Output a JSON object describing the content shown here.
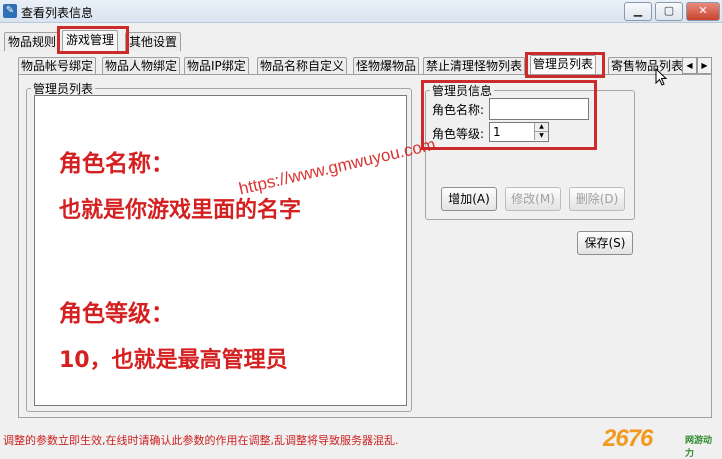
{
  "window": {
    "title": "查看列表信息",
    "controls": {
      "minimize": "▁",
      "maximize": "▢",
      "close": "✕"
    }
  },
  "main_tabs": [
    "物品规则",
    "游戏管理",
    "其他设置"
  ],
  "sub_tabs": [
    "物品帐号绑定",
    "物品人物绑定",
    "物品IP绑定",
    "物品名称自定义",
    "怪物爆物品",
    "禁止清理怪物列表",
    "管理员列表",
    "寄售物品列表"
  ],
  "sub_tab_scroll": {
    "left": "◀",
    "right": "▶"
  },
  "admin_list": {
    "title": "管理员列表"
  },
  "admin_info": {
    "title": "管理员信息",
    "name_label": "角色名称:",
    "name_value": "",
    "level_label": "角色等级:",
    "level_value": "1"
  },
  "buttons": {
    "add": "增加(A)",
    "edit": "修改(M)",
    "delete": "删除(D)",
    "save": "保存(S)"
  },
  "annotation": {
    "line1": "角色名称：",
    "line2": "也就是你游戏里面的名字",
    "line3": "角色等级：",
    "line4": "10，也就是最高管理员"
  },
  "watermark": "https://www.gmwuyou.com",
  "status_text": "调整的参数立即生效,在线时请确认此参数的作用在调整,乱调整将导致服务器混乱.",
  "logo": {
    "number": "2676",
    "tagline": "网游动力"
  },
  "colors": {
    "highlight": "#cc2b2b",
    "annotation": "#d42020"
  }
}
